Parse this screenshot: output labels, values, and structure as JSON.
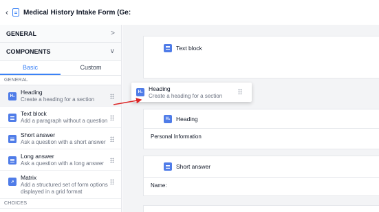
{
  "header": {
    "title": "Medical History Intake Form (Ge:"
  },
  "sidebar": {
    "general_label": "GENERAL",
    "components_label": "COMPONENTS",
    "tabs": [
      "Basic",
      "Custom"
    ],
    "section_general": "GENERAL",
    "section_choices": "CHOICES",
    "items": [
      {
        "name": "Heading",
        "desc": "Create a heading for a section"
      },
      {
        "name": "Text block",
        "desc": "Add a paragraph without a question"
      },
      {
        "name": "Short answer",
        "desc": "Ask a question with a short answer"
      },
      {
        "name": "Long answer",
        "desc": "Ask a question with a long answer"
      },
      {
        "name": "Matrix",
        "desc": "Add a structured set of form options displayed in a grid format"
      }
    ]
  },
  "drag": {
    "name": "Heading",
    "desc": "Create a heading for a section"
  },
  "canvas": {
    "cards": [
      {
        "label": "Text block",
        "body": ""
      },
      {
        "label": "Heading",
        "body": "Personal Information"
      },
      {
        "label": "Short answer",
        "body": "Name:"
      }
    ]
  },
  "colors": {
    "accent": "#3b82f6",
    "icon_bg": "#4f7ce8",
    "arrow": "#dc2626"
  }
}
